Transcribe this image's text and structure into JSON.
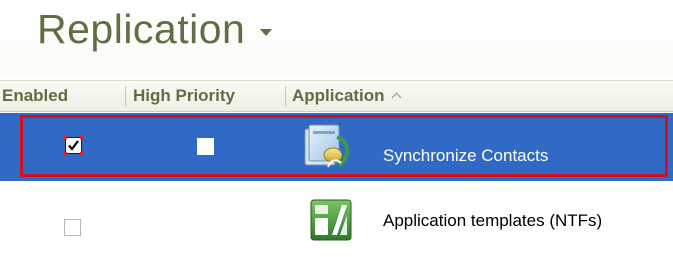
{
  "view": {
    "title": "Replication"
  },
  "columns": {
    "enabled": "Enabled",
    "high_priority": "High Priority",
    "application": "Application"
  },
  "rows": [
    {
      "enabled": true,
      "high_priority": false,
      "selected": true,
      "icon": "sync-contacts-icon",
      "application": "Synchronize Contacts"
    },
    {
      "enabled": false,
      "high_priority": false,
      "selected": false,
      "icon": "application-templates-icon",
      "application": "Application templates (NTFs)"
    }
  ],
  "colors": {
    "title": "#5f6e43",
    "selection": "#316ac5",
    "highlight_outline": "#d10f1d"
  }
}
